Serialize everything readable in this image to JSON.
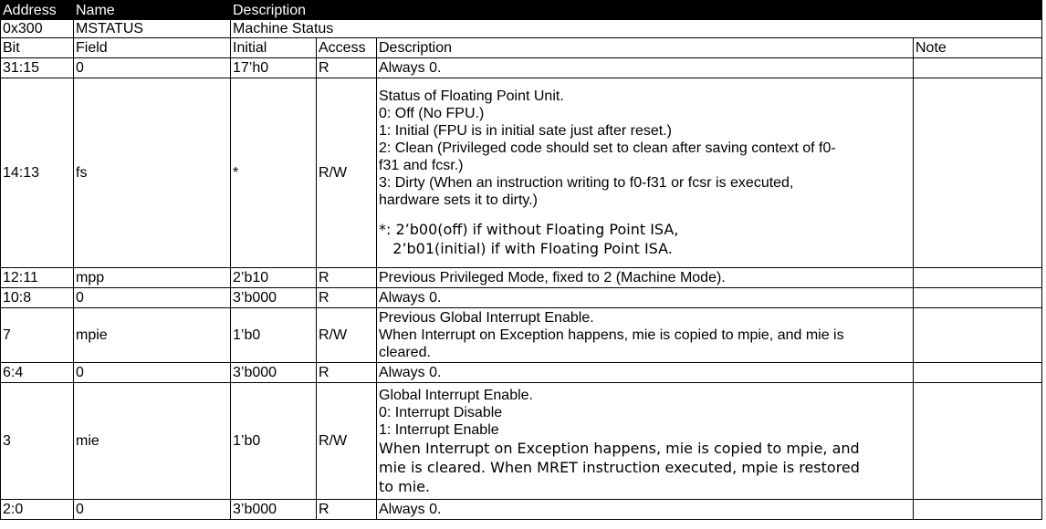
{
  "register": {
    "headers": {
      "address": "Address",
      "name": "Name",
      "description": "Description"
    },
    "address": "0x300",
    "name": "MSTATUS",
    "description": "Machine Status"
  },
  "fields_header": {
    "bit": "Bit",
    "field": "Field",
    "initial": "Initial",
    "access": "Access",
    "description": "Description",
    "note": "Note"
  },
  "rows": [
    {
      "bit": "31:15",
      "field": "0",
      "initial": "17’h0",
      "access": "R",
      "desc": [
        "Always 0."
      ],
      "note": ""
    },
    {
      "bit": "14:13",
      "field": "fs",
      "initial": "*",
      "access": "R/W",
      "desc": [
        "Status of Floating Point Unit.",
        "0: Off (No FPU.)",
        "1: Initial (FPU is in initial sate just after reset.)",
        "2: Clean (Privileged code should set to clean after saving context of f0-",
        "f31 and fcsr.)",
        "3: Dirty (When an instruction writing to f0-f31 or fcsr is executed,",
        "hardware sets it to dirty.)"
      ],
      "footnote": [
        "*: 2’b00(off) if without Floating Point ISA,",
        "   2’b01(initial) if with Floating Point ISA."
      ],
      "note": ""
    },
    {
      "bit": "12:11",
      "field": "mpp",
      "initial": "2’b10",
      "access": "R",
      "desc": [
        "Previous Privileged Mode, fixed to 2 (Machine Mode)."
      ],
      "note": ""
    },
    {
      "bit": "10:8",
      "field": "0",
      "initial": "3’b000",
      "access": "R",
      "desc": [
        "Always 0."
      ],
      "note": ""
    },
    {
      "bit": "7",
      "field": "mpie",
      "initial": "1’b0",
      "access": "R/W",
      "desc": [
        "Previous Global Interrupt Enable.",
        "When Interrupt on Exception happens, mie is copied to mpie, and mie is",
        "cleared."
      ],
      "note": ""
    },
    {
      "bit": "6:4",
      "field": "0",
      "initial": "3’b000",
      "access": "R",
      "desc": [
        "Always 0."
      ],
      "note": ""
    },
    {
      "bit": "3",
      "field": "mie",
      "initial": "1’b0",
      "access": "R/W",
      "desc": [
        "Global Interrupt Enable.",
        "0: Interrupt Disable",
        "1: Interrupt Enable"
      ],
      "desc2": [
        "When Interrupt on Exception happens, mie is copied to mpie, and",
        "mie is cleared. When MRET instruction executed, mpie is restored",
        "to mie."
      ],
      "note": ""
    },
    {
      "bit": "2:0",
      "field": "0",
      "initial": "3’b000",
      "access": "R",
      "desc": [
        "Always 0."
      ],
      "note": ""
    }
  ]
}
